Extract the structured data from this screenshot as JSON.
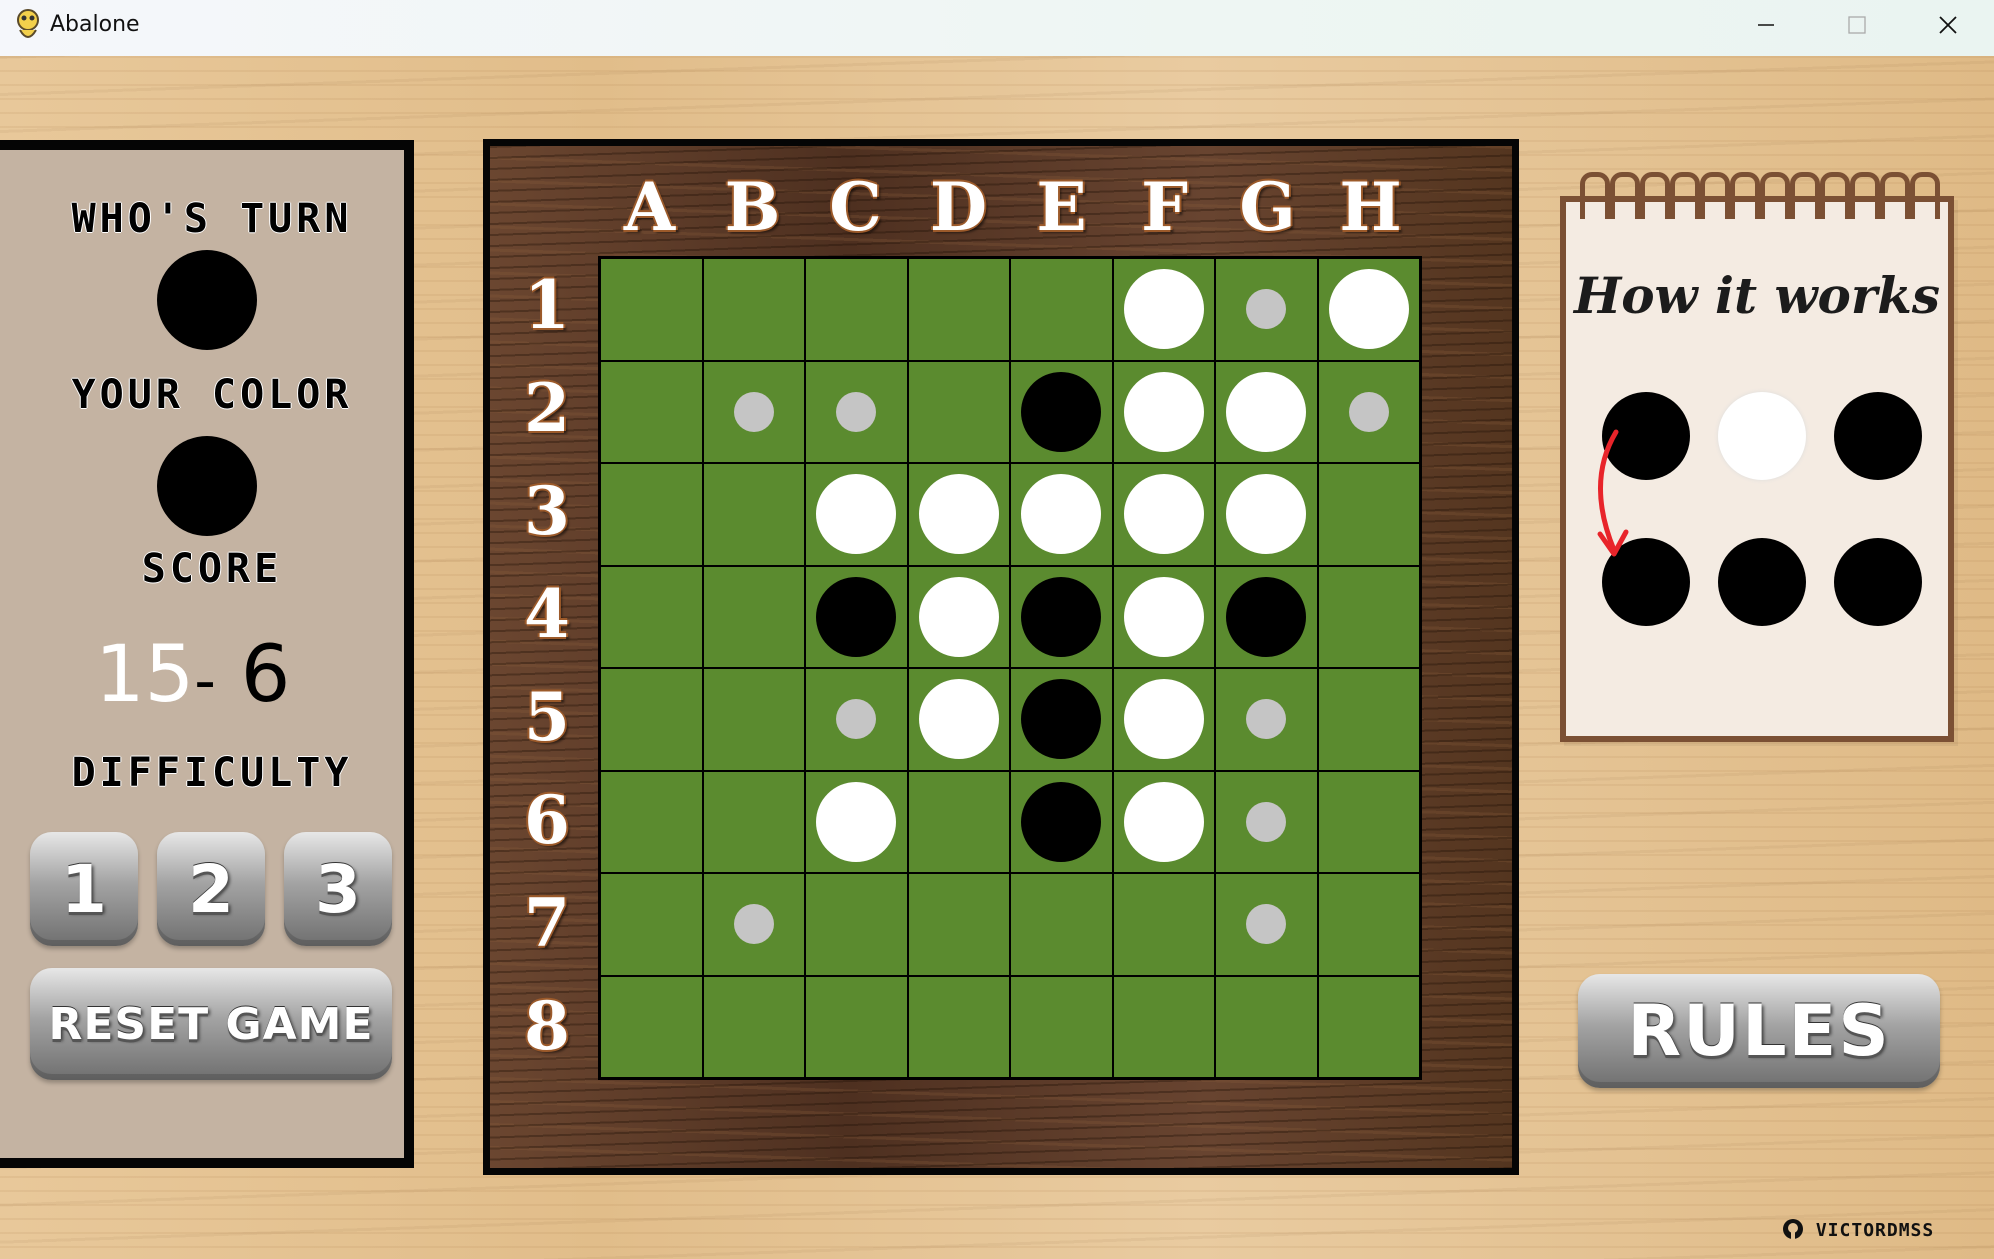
{
  "window": {
    "title": "Abalone",
    "controls": {
      "minimize": "minimize-icon",
      "maximize": "maximize-icon",
      "close": "close-icon"
    }
  },
  "left_panel": {
    "turn_label": "WHO'S TURN",
    "turn_color": "black",
    "your_color_label": "YOUR COLOR",
    "your_color": "black",
    "score_label": "SCORE",
    "score_white": "15",
    "score_separator": "-",
    "score_black": "6",
    "difficulty_label": "DIFFICULTY",
    "difficulty_options": [
      "1",
      "2",
      "3"
    ],
    "reset_label": "RESET GAME"
  },
  "board": {
    "columns": [
      "A",
      "B",
      "C",
      "D",
      "E",
      "F",
      "G",
      "H"
    ],
    "rows": [
      "1",
      "2",
      "3",
      "4",
      "5",
      "6",
      "7",
      "8"
    ],
    "cells": [
      [
        "",
        "",
        "",
        "",
        "",
        "W",
        "h",
        "W"
      ],
      [
        "",
        "h",
        "h",
        "",
        "B",
        "W",
        "W",
        "h"
      ],
      [
        "",
        "",
        "W",
        "W",
        "W",
        "W",
        "W",
        ""
      ],
      [
        "",
        "",
        "B",
        "W",
        "B",
        "W",
        "B",
        ""
      ],
      [
        "",
        "",
        "h",
        "W",
        "B",
        "W",
        "h",
        ""
      ],
      [
        "",
        "",
        "W",
        "",
        "B",
        "W",
        "h",
        ""
      ],
      [
        "",
        "h",
        "",
        "",
        "",
        "",
        "h",
        ""
      ],
      [
        "",
        "",
        "",
        "",
        "",
        "",
        "",
        ""
      ]
    ],
    "legend": {
      "W": "white",
      "B": "black",
      "h": "hint"
    }
  },
  "how_it_works": {
    "title": "How it works",
    "before": [
      "black",
      "white",
      "black"
    ],
    "after": [
      "black",
      "black",
      "black"
    ]
  },
  "rules_label": "RULES",
  "credit": "VICTORDMSS",
  "colors": {
    "board_green": "#5b8b2f",
    "hint_grey": "#c5c5c5",
    "panel_bg": "#c4b3a2",
    "arrow_red": "#e8242a"
  }
}
